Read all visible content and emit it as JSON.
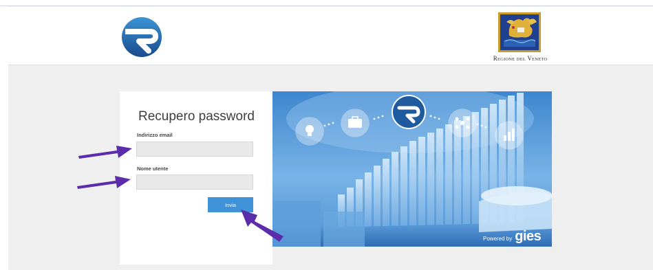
{
  "region": {
    "name_big1": "R",
    "name_small1": "EGIONE",
    "name_small2": "DEL",
    "name_big2": "V",
    "name_small3": "ENETO"
  },
  "form": {
    "title": "Recupero password",
    "email_label": "Indirizzo email",
    "email_value": "",
    "username_label": "Nome utente",
    "username_value": "",
    "submit_label": "Invia"
  },
  "hero": {
    "powered_by": "Powered by",
    "brand": "gies"
  },
  "colors": {
    "accent": "#3f91d8",
    "annotation_arrow": "#5b2dab",
    "background": "#efefef"
  },
  "icons": [
    "brand-r-logo-icon",
    "regione-veneto-seal-icon",
    "lightbulb-icon",
    "briefcase-icon",
    "brand-r-logo-icon",
    "network-icon",
    "bar-chart-icon"
  ]
}
